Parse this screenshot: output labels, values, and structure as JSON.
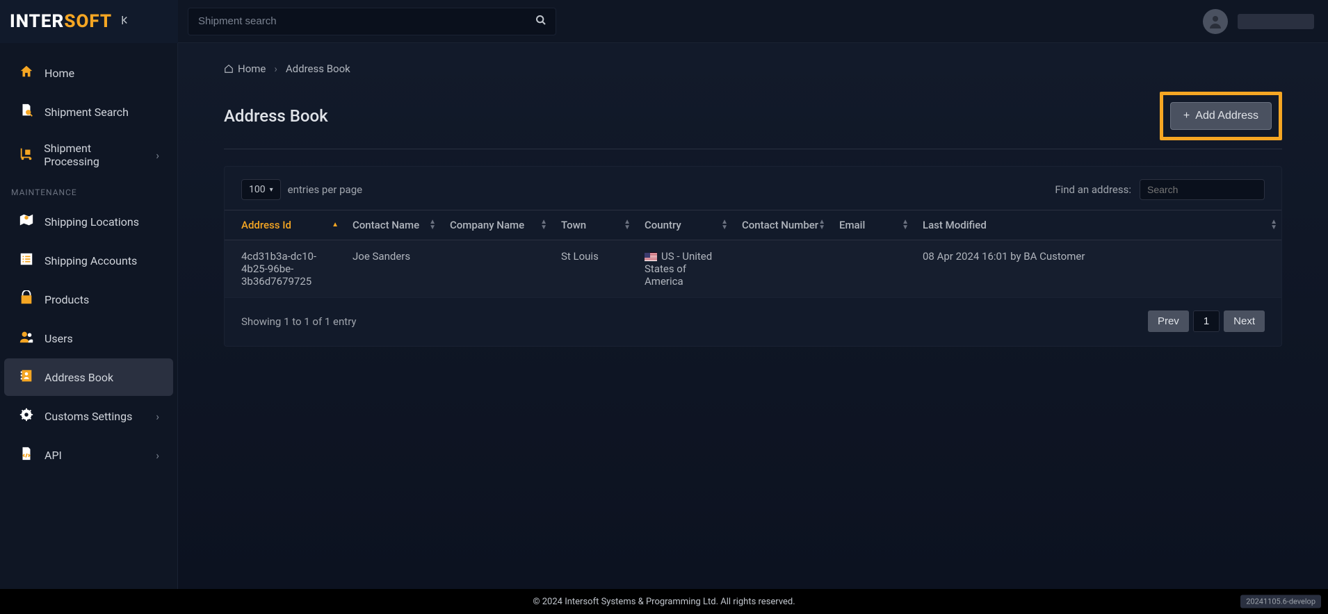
{
  "brand": {
    "part1": "INTER",
    "part2": "SOFT"
  },
  "search": {
    "placeholder": "Shipment search"
  },
  "sidebar": {
    "items_top": [
      {
        "label": "Home",
        "name": "nav-home"
      },
      {
        "label": "Shipment Search",
        "name": "nav-shipment-search"
      },
      {
        "label": "Shipment Processing",
        "name": "nav-shipment-processing",
        "chevron": true
      }
    ],
    "section_label": "MAINTENANCE",
    "items_maint": [
      {
        "label": "Shipping Locations",
        "name": "nav-shipping-locations"
      },
      {
        "label": "Shipping Accounts",
        "name": "nav-shipping-accounts"
      },
      {
        "label": "Products",
        "name": "nav-products"
      },
      {
        "label": "Users",
        "name": "nav-users"
      },
      {
        "label": "Address Book",
        "name": "nav-address-book",
        "active": true
      },
      {
        "label": "Customs Settings",
        "name": "nav-customs-settings",
        "chevron": true
      },
      {
        "label": "API",
        "name": "nav-api",
        "chevron": true
      }
    ]
  },
  "breadcrumb": {
    "home": "Home",
    "current": "Address Book"
  },
  "page_title": "Address Book",
  "add_button": "Add Address",
  "entries": {
    "value": "100",
    "suffix": "entries per page"
  },
  "find": {
    "label": "Find an address:",
    "placeholder": "Search"
  },
  "columns": [
    "Address Id",
    "Contact Name",
    "Company Name",
    "Town",
    "Country",
    "Contact Number",
    "Email",
    "Last Modified"
  ],
  "rows": [
    {
      "address_id": "4cd31b3a-dc10-4b25-96be-3b36d7679725",
      "contact_name": "Joe Sanders",
      "company_name": "",
      "town": "St Louis",
      "country": "US - United States of America",
      "contact_number": "",
      "email": "",
      "last_modified": "08 Apr 2024 16:01 by BA Customer"
    }
  ],
  "showing": "Showing 1 to 1 of 1 entry",
  "pager": {
    "prev": "Prev",
    "page": "1",
    "next": "Next"
  },
  "footer": "© 2024 Intersoft Systems & Programming Ltd. All rights reserved.",
  "build": "20241105.6-develop"
}
